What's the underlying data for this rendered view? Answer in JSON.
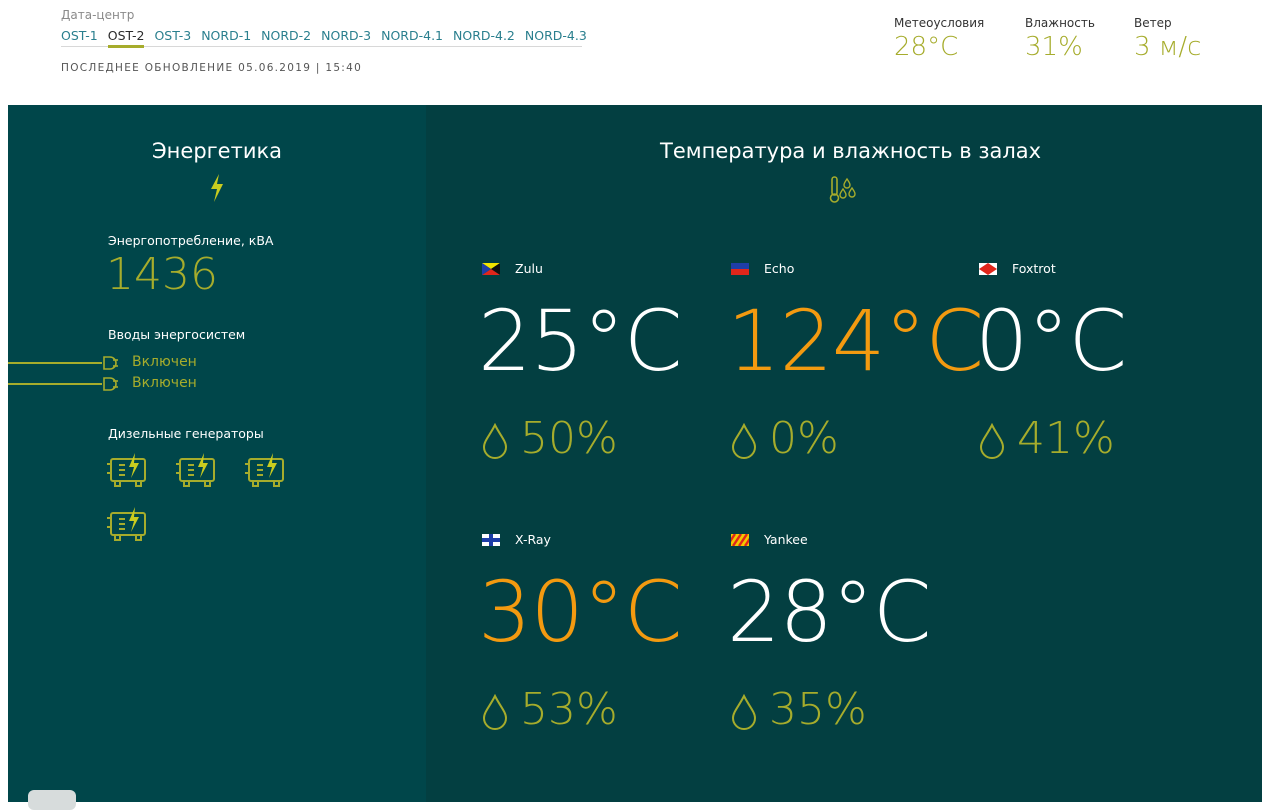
{
  "header": {
    "dc_label": "Дата-центр",
    "tabs": [
      "OST-1",
      "OST-2",
      "OST-3",
      "NORD-1",
      "NORD-2",
      "NORD-3",
      "NORD-4.1",
      "NORD-4.2",
      "NORD-4.3"
    ],
    "active_tab": "OST-2",
    "last_update": "ПОСЛЕДНЕЕ ОБНОВЛЕНИЕ 05.06.2019 | 15:40",
    "weather": [
      {
        "label": "Метеоусловия",
        "value": "28°C"
      },
      {
        "label": "Влажность",
        "value": "31%"
      },
      {
        "label": "Ветер",
        "value": "3 м/с"
      }
    ]
  },
  "energy": {
    "title": "Энергетика",
    "consumption_label": "Энергопотребление, кВА",
    "consumption_value": "1436",
    "inputs_label": "Вводы энергосистем",
    "inputs": [
      "Включен",
      "Включен"
    ],
    "generators_label": "Дизельные генераторы",
    "generator_count": 4
  },
  "rooms_panel": {
    "title": "Температура и влажность в залах",
    "rooms": [
      {
        "name": "Zulu",
        "temp": "25°C",
        "humidity": "50%",
        "temp_color": "#ffffff",
        "flag": "zulu-flag-icon"
      },
      {
        "name": "Echo",
        "temp": "124°C",
        "humidity": "0%",
        "temp_color": "#f39a10",
        "flag": "echo-flag-icon"
      },
      {
        "name": "Foxtrot",
        "temp": "0°C",
        "humidity": "41%",
        "temp_color": "#ffffff",
        "flag": "foxtrot-flag-icon"
      },
      {
        "name": "X-Ray",
        "temp": "30°C",
        "humidity": "53%",
        "temp_color": "#f39a10",
        "flag": "xray-flag-icon"
      },
      {
        "name": "Yankee",
        "temp": "28°C",
        "humidity": "35%",
        "temp_color": "#ffffff",
        "flag": "yankee-flag-icon"
      }
    ]
  },
  "colors": {
    "accent": "#a6ac2c",
    "warning": "#f39a10",
    "left_bg": "#00464a",
    "right_bg": "#033f41",
    "link": "#2a7f8e"
  }
}
